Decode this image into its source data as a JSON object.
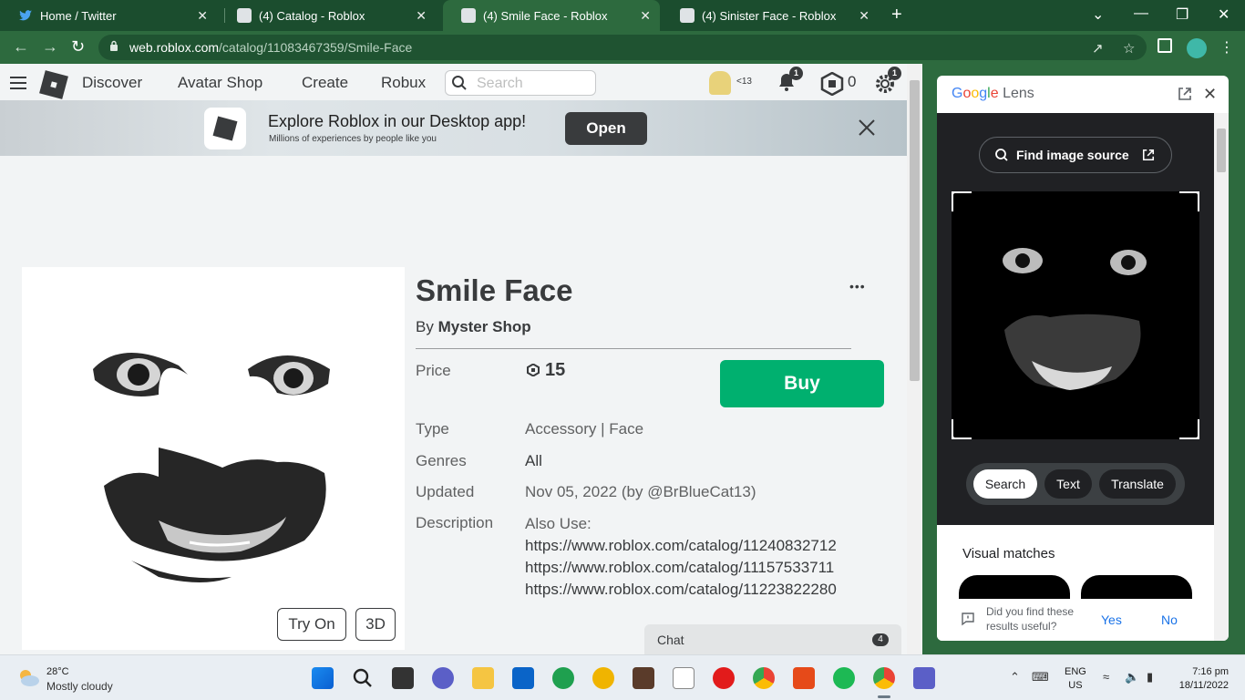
{
  "browser": {
    "tabs": [
      {
        "title": "Home / Twitter",
        "icon": "twitter-icon",
        "active": false
      },
      {
        "title": "(4) Catalog - Roblox",
        "icon": "roblox-icon",
        "active": false
      },
      {
        "title": "(4) Smile Face - Roblox",
        "icon": "roblox-icon",
        "active": true
      },
      {
        "title": "(4) Sinister Face - Roblox",
        "icon": "roblox-icon",
        "active": false
      }
    ],
    "new_tab": "+",
    "close_glyph": "✕",
    "url_host": "web.roblox.com",
    "url_path": "/catalog/11083467359/Smile-Face"
  },
  "roblox_nav": {
    "links": [
      "Discover",
      "Avatar Shop",
      "Create",
      "Robux"
    ],
    "search_placeholder": "Search",
    "age_label": "<13",
    "notification_count": "1",
    "robux_balance": "0",
    "settings_badge": "1"
  },
  "banner": {
    "title": "Explore Roblox in our Desktop app!",
    "subtitle": "Millions of experiences by people like you",
    "open_label": "Open"
  },
  "item": {
    "name": "Smile Face",
    "by_prefix": "By",
    "creator": "Myster Shop",
    "more_glyph": "•••",
    "price_label": "Price",
    "price": "15",
    "buy_label": "Buy",
    "type_label": "Type",
    "type_value": "Accessory | Face",
    "genres_label": "Genres",
    "genres_value": "All",
    "updated_label": "Updated",
    "updated_value": "Nov 05, 2022 (by @BrBlueCat13)",
    "description_label": "Description",
    "description_lines": [
      "Also Use:",
      "https://www.roblox.com/catalog/11240832712",
      "https://www.roblox.com/catalog/11157533711",
      "https://www.roblox.com/catalog/11223822280"
    ],
    "try_on_label": "Try On",
    "view_3d_label": "3D"
  },
  "chat": {
    "label": "Chat",
    "count": "4"
  },
  "lens": {
    "title_parts": [
      "G",
      "o",
      "o",
      "g",
      "l",
      "e"
    ],
    "title_suffix": " Lens",
    "find_source_label": "Find image source",
    "modes": [
      "Search",
      "Text",
      "Translate"
    ],
    "active_mode": "Search",
    "visual_matches_label": "Visual matches",
    "feedback_question": "Did you find these results useful?",
    "feedback_yes": "Yes",
    "feedback_no": "No"
  },
  "taskbar": {
    "temperature": "28°C",
    "weather": "Mostly cloudy",
    "lang_line1": "ENG",
    "lang_line2": "US",
    "time": "7:16 pm",
    "date": "18/11/2022"
  },
  "colors": {
    "chrome_frame": "#1b4d2e",
    "chrome_toolbar": "#2d6a3e",
    "buy_green": "#00b06f",
    "roblox_text": "#393b3d"
  }
}
